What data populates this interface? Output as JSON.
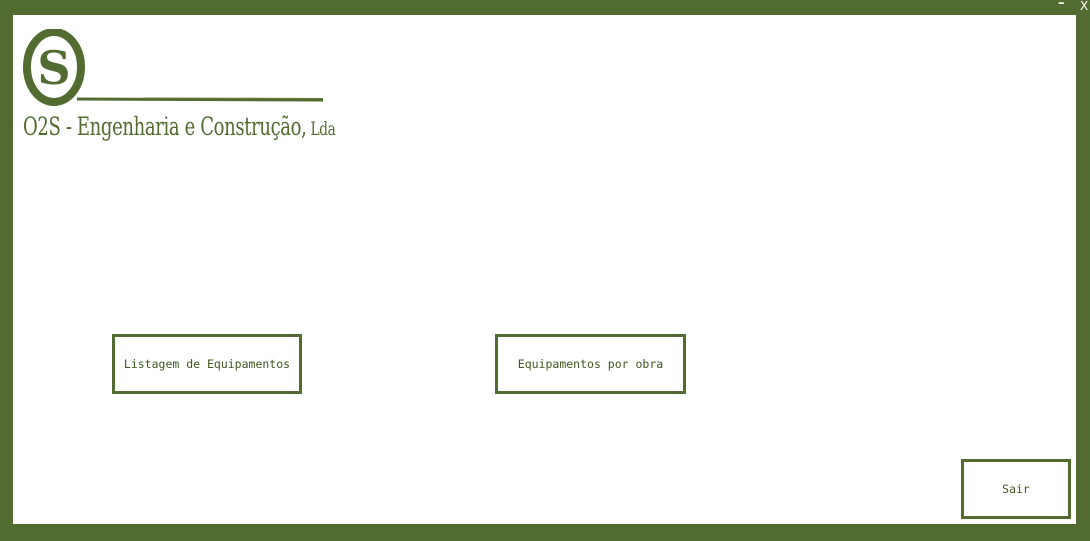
{
  "window": {
    "minimize_label": "–",
    "close_label": "X"
  },
  "logo": {
    "mark_letter": "S",
    "company_name": "O2S - Engenharia e Construção,",
    "company_suffix": " Lda",
    "color": "#526b30"
  },
  "buttons": {
    "listagem_label": "Listagem de Equipamentos",
    "por_obra_label": "Equipamentos por obra",
    "sair_label": "Sair"
  },
  "colors": {
    "frame": "#526b30",
    "background": "#ffffff",
    "text": "#3e5720"
  }
}
